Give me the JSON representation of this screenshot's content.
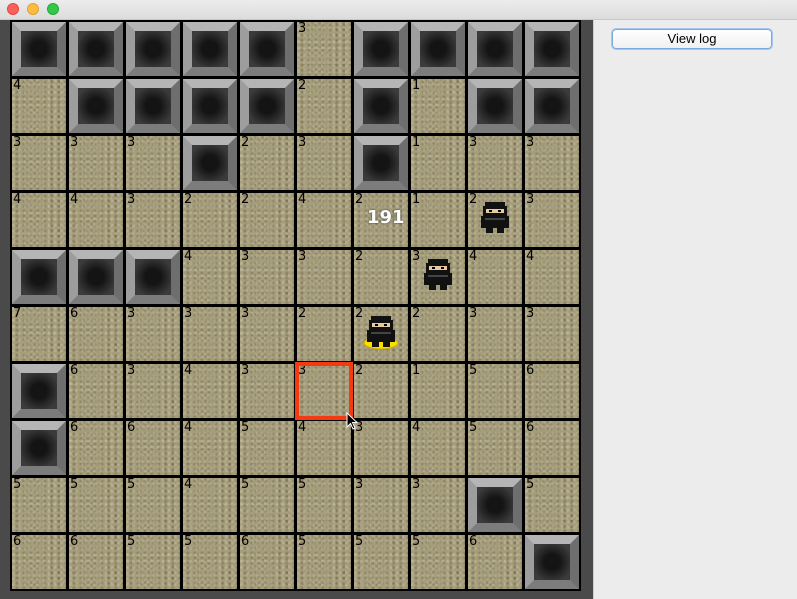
{
  "window": {
    "controls": [
      "close",
      "minimize",
      "zoom"
    ]
  },
  "side_panel": {
    "view_log_label": "View log"
  },
  "board": {
    "rows": [
      [
        "P",
        "P",
        "P",
        "P",
        "P",
        "3",
        "P",
        "P",
        "P",
        "P"
      ],
      [
        "4",
        "P",
        "P",
        "P",
        "P",
        "2",
        "P",
        "1",
        "P",
        "P"
      ],
      [
        "3",
        "3",
        "3",
        "P",
        "2",
        "3",
        "P",
        "1",
        "3",
        "3"
      ],
      [
        "4",
        "4",
        "3",
        "2",
        "2",
        "4",
        "2",
        "1",
        "2",
        "3"
      ],
      [
        "P",
        "P",
        "P",
        "4",
        "3",
        "3",
        "2",
        "3",
        "4",
        "4"
      ],
      [
        "7",
        "6",
        "3",
        "3",
        "3",
        "2",
        "2",
        "2",
        "3",
        "3"
      ],
      [
        "P",
        "6",
        "3",
        "4",
        "3",
        "3",
        "2",
        "1",
        "5",
        "6"
      ],
      [
        "P",
        "6",
        "6",
        "4",
        "5",
        "4",
        "3",
        "4",
        "5",
        "6"
      ],
      [
        "5",
        "5",
        "5",
        "4",
        "5",
        "5",
        "3",
        "3",
        "P",
        "5"
      ],
      [
        "6",
        "6",
        "5",
        "5",
        "6",
        "5",
        "5",
        "5",
        "6",
        "P"
      ]
    ],
    "legend": {
      "P": "pit",
      "number": "floor tile with value"
    },
    "ninjas": [
      {
        "row": 3,
        "col": 8,
        "highlighted": false
      },
      {
        "row": 4,
        "col": 7,
        "highlighted": false
      },
      {
        "row": 5,
        "col": 6,
        "highlighted": true
      }
    ],
    "score": {
      "value": "191",
      "row": 3,
      "col": 6
    },
    "selected": {
      "row": 6,
      "col": 5
    },
    "colors": {
      "selection": "#f53a12",
      "highlight": "#f5e000",
      "floor": "#a59c78",
      "grid": "#000000"
    }
  }
}
